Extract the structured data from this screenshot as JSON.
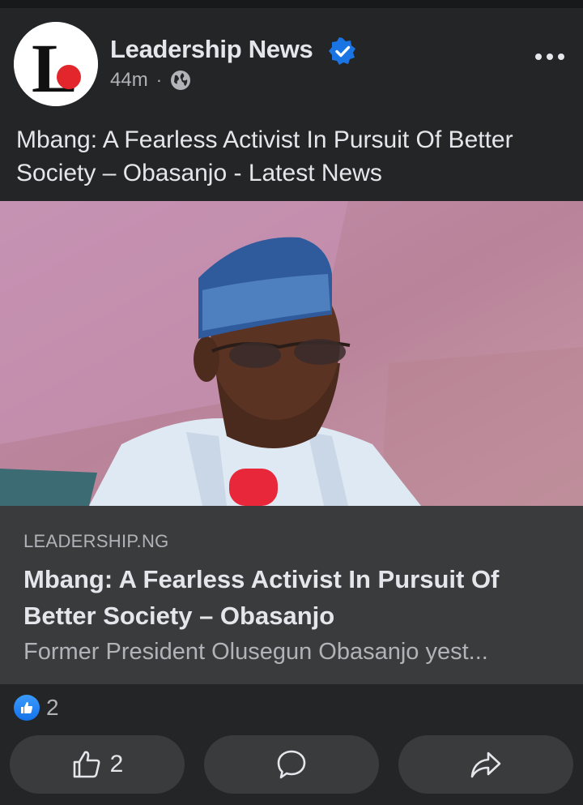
{
  "post": {
    "page_name": "Leadership News",
    "time": "44m",
    "separator": "·",
    "audience_icon": "globe-icon",
    "more_icon": "more-options-icon",
    "text": "Mbang: A Fearless Activist In Pursuit Of Better Society – Obasanjo - Latest News",
    "avatar_letter": "L"
  },
  "link_preview": {
    "domain": "LEADERSHIP.NG",
    "title": "Mbang: A Fearless Activist In Pursuit Of Better Society – Obasanjo",
    "description": "Former President Olusegun Obasanjo yest..."
  },
  "reactions": {
    "icon": "like-reaction-icon",
    "count": "2"
  },
  "actions": {
    "like_count": "2",
    "like_icon": "thumbs-up-icon",
    "comment_icon": "comment-icon",
    "share_icon": "share-icon"
  },
  "colors": {
    "background": "#242526",
    "link_box": "#3a3b3c",
    "verified_blue": "#1b74e4",
    "logo_red": "#e3262b"
  }
}
